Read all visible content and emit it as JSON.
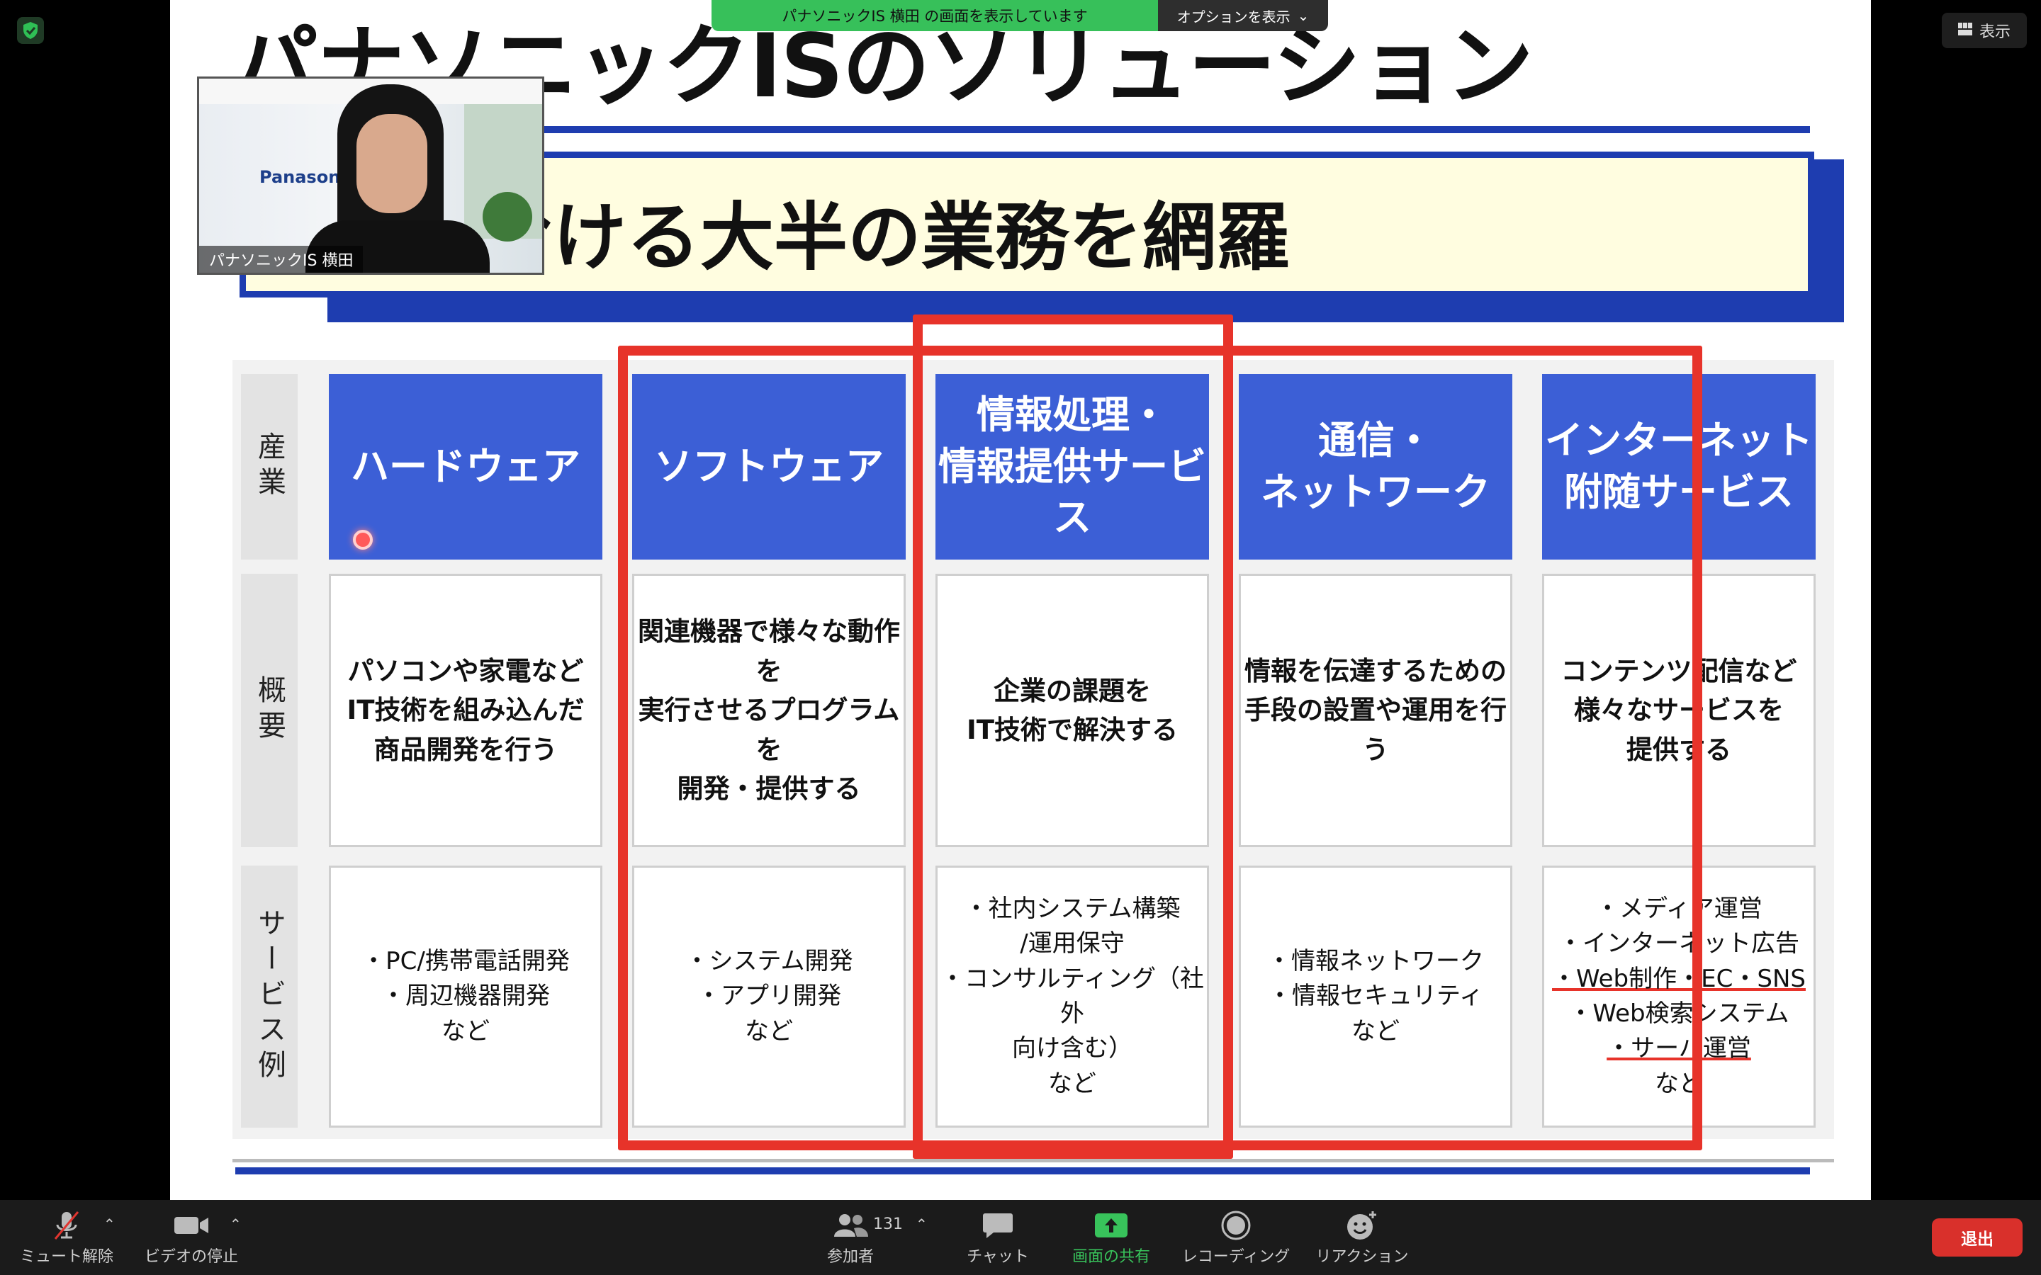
{
  "share_banner": {
    "message": "パナソニックIS 横田 の画面を表示しています",
    "options_label": "オプションを表示"
  },
  "view_button": {
    "label": "表示"
  },
  "slide": {
    "title": "パナソニックISのソリューション",
    "banner": "界における大半の業務を網羅",
    "row_labels": [
      "産業",
      "概要",
      "サービス例"
    ],
    "columns": [
      {
        "header": "ハードウェア",
        "summary": "パソコンや家電など\nIT技術を組み込んだ\n商品開発を行う",
        "examples": "・PC/携帯電話開発\n・周辺機器開発\nなど"
      },
      {
        "header": "ソフトウェア",
        "summary": "関連機器で様々な動作を\n実行させるプログラムを\n開発・提供する",
        "examples": "・システム開発\n・アプリ開発\nなど"
      },
      {
        "header": "情報処理・\n情報提供サービス",
        "summary": "企業の課題を\nIT技術で解決する",
        "examples": "・社内システム構築\n/運用保守\n・コンサルティング（社外\n向け含む）\nなど"
      },
      {
        "header": "通信・\nネットワーク",
        "summary": "情報を伝達するための\n手段の設置や運用を行う",
        "examples": "・情報ネットワーク\n・情報セキュリティ\nなど"
      },
      {
        "header": "インターネット\n附随サービス",
        "summary": "コンテンツ配信など\n様々なサービスを\n提供する",
        "examples_lines": [
          "・メディア運営",
          "・インターネット広告",
          "・Web制作・EC・SNS",
          "・Web検索システム",
          "・サーバ運営",
          "など"
        ]
      }
    ]
  },
  "video": {
    "name": "パナソニックIS 横田",
    "wall_logo": "Panasonic"
  },
  "toolbar": {
    "unmute": "ミュート解除",
    "stop_video": "ビデオの停止",
    "participants": "参加者",
    "participant_count": "131",
    "chat": "チャット",
    "share_screen": "画面の共有",
    "recording": "レコーディング",
    "reactions": "リアクション",
    "leave": "退出"
  },
  "colors": {
    "accent_green": "#37c05a",
    "leave_red": "#d9302b",
    "slide_blue": "#3c5fd6",
    "highlight_red": "#e7332a"
  }
}
